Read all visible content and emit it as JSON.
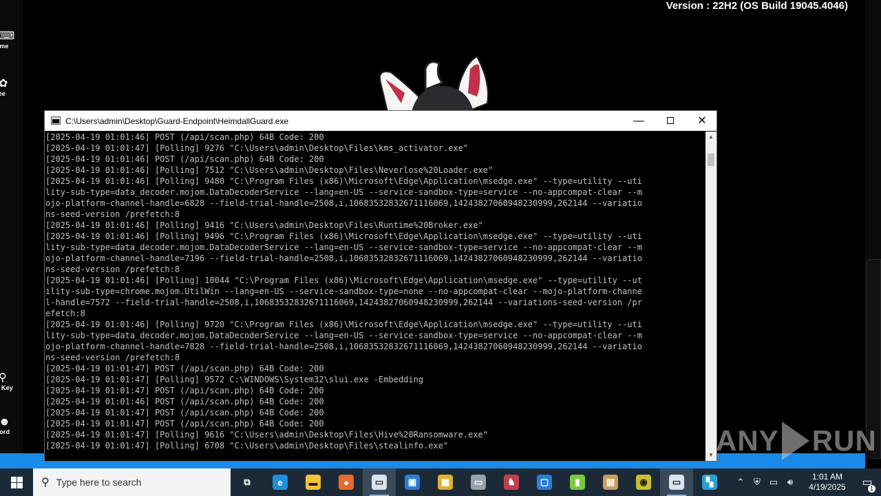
{
  "desktop": {
    "version_text": "Version : 22H2 (OS Build 19045.4046)",
    "left_icons": [
      {
        "label": "ame",
        "icon": "gamepad-icon"
      },
      {
        "label": "ree",
        "icon": "puzzle-icon"
      },
      {
        "label": "y Key",
        "icon": "key-icon"
      },
      {
        "label": "cord",
        "icon": "discord-icon"
      }
    ],
    "watermark": {
      "left": "ANY",
      "right": "RUN"
    }
  },
  "console": {
    "title": "C:\\Users\\admin\\Desktop\\Guard-Endpoint\\HeimdallGuard.exe",
    "minimize": "—",
    "close": "✕",
    "lines": [
      "[2025-04-19 01:01:46] POST (/api/scan.php) 64B Code: 200",
      "[2025-04-19 01:01:47] [Polling] 9276 \"C:\\Users\\admin\\Desktop\\Files\\kms_activator.exe\"",
      "[2025-04-19 01:01:46] POST (/api/scan.php) 64B Code: 200",
      "[2025-04-19 01:01:46] [Polling] 7512 \"C:\\Users\\admin\\Desktop\\Files\\Neverlose%20Loader.exe\"",
      "[2025-04-19 01:01:46] [Polling] 9480 \"C:\\Program Files (x86)\\Microsoft\\Edge\\Application\\msedge.exe\" --type=utility --uti",
      "lity-sub-type=data_decoder.mojom.DataDecoderService --lang=en-US --service-sandbox-type=service --no-appcompat-clear --m",
      "ojo-platform-channel-handle=6828 --field-trial-handle=2508,i,10683532832671116069,14243827060948230999,262144 --variatio",
      "ns-seed-version /prefetch:8",
      "[2025-04-19 01:01:46] [Polling] 9416 \"C:\\Users\\admin\\Desktop\\Files\\Runtime%20Broker.exe\"",
      "[2025-04-19 01:01:46] [Polling] 9496 \"C:\\Program Files (x86)\\Microsoft\\Edge\\Application\\msedge.exe\" --type=utility --uti",
      "lity-sub-type=data_decoder.mojom.DataDecoderService --lang=en-US --service-sandbox-type=service --no-appcompat-clear --m",
      "ojo-platform-channel-handle=7196 --field-trial-handle=2508,i,10683532832671116069,14243827060948230999,262144 --variatio",
      "ns-seed-version /prefetch:8",
      "[2025-04-19 01:01:46] [Polling] 10044 \"C:\\Program Files (x86)\\Microsoft\\Edge\\Application\\msedge.exe\" --type=utility --ut",
      "ility-sub-type=chrome.mojom.UtilWin --lang=en-US --service-sandbox-type=none --no-appcompat-clear --mojo-platform-channe",
      "l-handle=7572 --field-trial-handle=2508,i,10683532832671116069,14243827060948230999,262144 --variations-seed-version /pr",
      "efetch:8",
      "[2025-04-19 01:01:46] [Polling] 9720 \"C:\\Program Files (x86)\\Microsoft\\Edge\\Application\\msedge.exe\" --type=utility --uti",
      "lity-sub-type=data_decoder.mojom.DataDecoderService --lang=en-US --service-sandbox-type=service --no-appcompat-clear --m",
      "ojo-platform-channel-handle=7828 --field-trial-handle=2508,i,10683532832671116069,14243827060948230999,262144 --variatio",
      "ns-seed-version /prefetch:8",
      "[2025-04-19 01:01:47] POST (/api/scan.php) 64B Code: 200",
      "[2025-04-19 01:01:47] [Polling] 9572 C:\\WINDOWS\\System32\\slui.exe -Embedding",
      "[2025-04-19 01:01:47] POST (/api/scan.php) 64B Code: 200",
      "[2025-04-19 01:01:46] POST (/api/scan.php) 64B Code: 200",
      "[2025-04-19 01:01:47] POST (/api/scan.php) 64B Code: 200",
      "[2025-04-19 01:01:47] POST (/api/scan.php) 64B Code: 200",
      "[2025-04-19 01:01:47] [Polling] 9616 \"C:\\Users\\admin\\Desktop\\Files\\Hive%20Ransomware.exe\"",
      "[2025-04-19 01:01:47] [Polling] 6708 \"C:\\Users\\admin\\Desktop\\Files\\stealinfo.exe\""
    ]
  },
  "taskbar": {
    "search_placeholder": "Type here to search",
    "apps": [
      {
        "name": "task-view",
        "icon": "task-view-icon",
        "glyph": "⧉",
        "color": "#1c2a38",
        "active": false
      },
      {
        "name": "edge",
        "icon": "edge-icon",
        "glyph": "e",
        "color": "#1f8fd6",
        "active": false
      },
      {
        "name": "file-explorer",
        "icon": "folder-icon",
        "glyph": "▬",
        "color": "#f3c13a",
        "active": false
      },
      {
        "name": "firefox",
        "icon": "firefox-icon",
        "glyph": "●",
        "color": "#e86a2c",
        "active": false
      },
      {
        "name": "console-window",
        "icon": "console-icon",
        "glyph": "▭",
        "color": "#d8e4ee",
        "active": true
      },
      {
        "name": "remote-desktop",
        "icon": "monitor-icon",
        "glyph": "▣",
        "color": "#2a7fd4",
        "active": false
      },
      {
        "name": "chip-app",
        "icon": "chip-icon",
        "glyph": "▦",
        "color": "#e0b030",
        "active": false
      },
      {
        "name": "disk-app",
        "icon": "drive-icon",
        "glyph": "▭",
        "color": "#9aa3ad",
        "active": false
      },
      {
        "name": "mascot-app",
        "icon": "mascot-icon",
        "glyph": "♞",
        "color": "#c0404a",
        "active": false
      },
      {
        "name": "window-app",
        "icon": "window-icon",
        "glyph": "▢",
        "color": "#2a7fd4",
        "active": false
      },
      {
        "name": "green-app",
        "icon": "leaf-icon",
        "glyph": "▮",
        "color": "#7ac943",
        "active": false
      },
      {
        "name": "calendar-app",
        "icon": "calendar-icon",
        "glyph": "▤",
        "color": "#c9a060",
        "active": false
      },
      {
        "name": "disc-app",
        "icon": "disc-icon",
        "glyph": "◉",
        "color": "#c8c030",
        "active": false
      },
      {
        "name": "console-window-2",
        "icon": "console-icon",
        "glyph": "▭",
        "color": "#d8e4ee",
        "active": true
      },
      {
        "name": "colored-app",
        "icon": "app-icon",
        "glyph": "▚",
        "color": "#2a9fd6",
        "active": false
      }
    ],
    "clock_time": "1:01 AM",
    "clock_date": "4/19/2025",
    "notification_count": "1"
  }
}
